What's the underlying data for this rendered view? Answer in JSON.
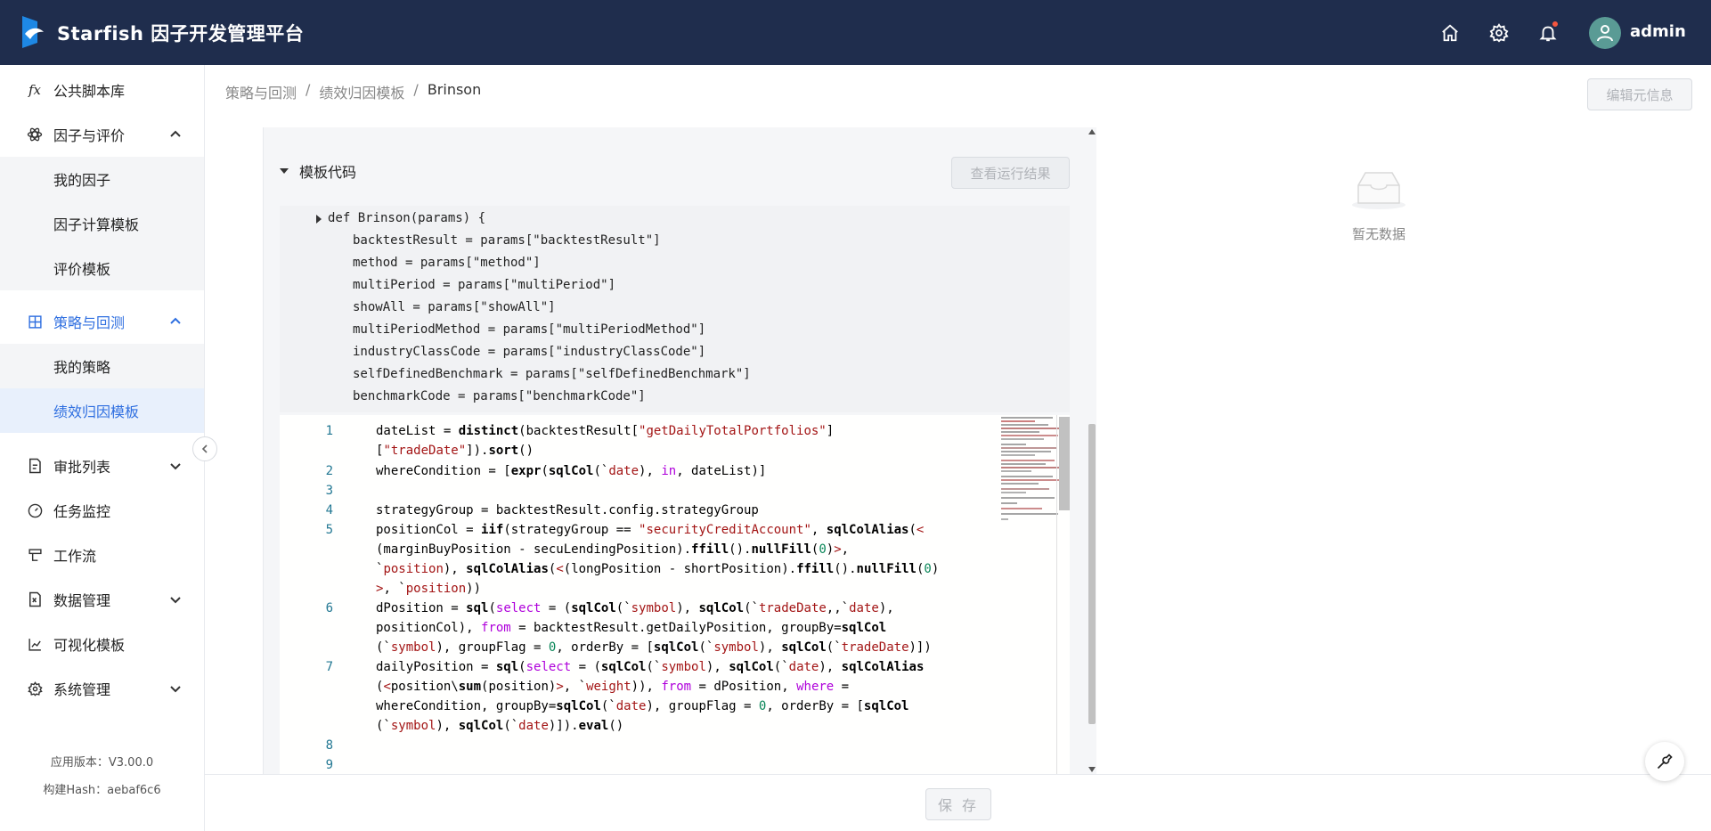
{
  "app": {
    "title": "Starfish 因子开发管理平台",
    "user": "admin"
  },
  "header": {
    "icons": [
      "home-icon",
      "settings-icon",
      "bell-icon"
    ]
  },
  "sidebar": {
    "items": [
      {
        "label": "公共脚本库",
        "icon": "fx-icon"
      },
      {
        "label": "因子与评价",
        "icon": "atom-icon"
      },
      {
        "label": "我的因子"
      },
      {
        "label": "因子计算模板"
      },
      {
        "label": "评价模板"
      },
      {
        "label": "策略与回测",
        "icon": "strategy-icon"
      },
      {
        "label": "我的策略"
      },
      {
        "label": "绩效归因模板"
      },
      {
        "label": "审批列表",
        "icon": "approval-icon"
      },
      {
        "label": "任务监控",
        "icon": "gauge-icon"
      },
      {
        "label": "工作流",
        "icon": "workflow-icon"
      },
      {
        "label": "数据管理",
        "icon": "data-icon"
      },
      {
        "label": "可视化模板",
        "icon": "chart-icon"
      },
      {
        "label": "系统管理",
        "icon": "gear-icon"
      }
    ],
    "version": "应用版本：V3.00.0",
    "build_hash": "构建Hash：aebaf6c6"
  },
  "breadcrumb": [
    "策略与回测",
    "绩效归因模板",
    "Brinson"
  ],
  "buttons": {
    "edit_meta": "编辑元信息",
    "view_result": "查看运行结果",
    "save": "保 存"
  },
  "section": {
    "title": "模板代码"
  },
  "code_preview": [
    "def Brinson(params) {",
    "backtestResult = params[\"backtestResult\"]",
    "method = params[\"method\"]",
    "multiPeriod = params[\"multiPeriod\"]",
    "showAll = params[\"showAll\"]",
    "multiPeriodMethod = params[\"multiPeriodMethod\"]",
    "industryClassCode = params[\"industryClassCode\"]",
    "selfDefinedBenchmark = params[\"selfDefinedBenchmark\"]",
    "benchmarkCode = params[\"benchmarkCode\"]"
  ],
  "line_numbers": [
    "1",
    "2",
    "3",
    "4",
    "5",
    "6",
    "7",
    "8",
    "9"
  ],
  "empty": {
    "text": "暂无数据"
  },
  "colors": {
    "header_bg": "#1f2d4d",
    "accent": "#2f6fe0",
    "line_number": "#237893",
    "string": "#a31515",
    "keyword_purple": "#af00db",
    "number": "#098658"
  }
}
